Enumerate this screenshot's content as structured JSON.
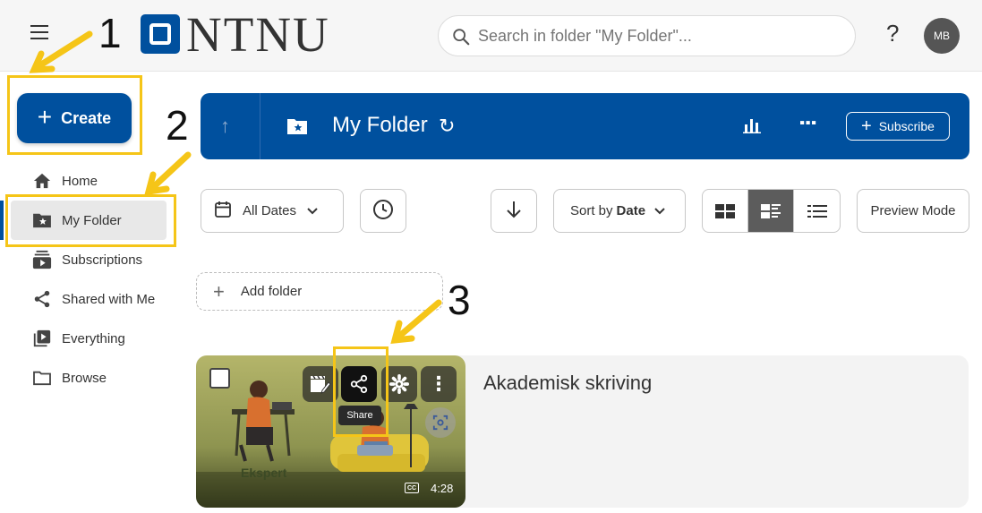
{
  "logo": {
    "text": "NTNU"
  },
  "search": {
    "placeholder": "Search in folder \"My Folder\"..."
  },
  "user": {
    "initials": "MB",
    "help": "?"
  },
  "annotations": [
    "1",
    "2",
    "3"
  ],
  "create": {
    "label": "Create"
  },
  "sidebar": {
    "items": [
      {
        "label": "Home",
        "icon": "home-icon"
      },
      {
        "label": "My Folder",
        "icon": "folder-star-icon",
        "active": true
      },
      {
        "label": "Subscriptions",
        "icon": "subscriptions-icon"
      },
      {
        "label": "Shared with Me",
        "icon": "share-icon"
      },
      {
        "label": "Everything",
        "icon": "library-icon"
      },
      {
        "label": "Browse",
        "icon": "folder-icon"
      }
    ]
  },
  "header": {
    "title": "My Folder",
    "subscribe": "Subscribe"
  },
  "filters": {
    "dates": "All Dates",
    "sort_prefix": "Sort by",
    "sort_value": "Date",
    "preview": "Preview Mode"
  },
  "add_folder": {
    "label": "Add folder"
  },
  "session": {
    "title": "Akademisk skriving",
    "duration": "4:28",
    "thumb_text": "Ekspert",
    "tooltip": "Share",
    "cc": "CC"
  },
  "colors": {
    "brand": "#00509e",
    "highlight": "#f5c518"
  }
}
